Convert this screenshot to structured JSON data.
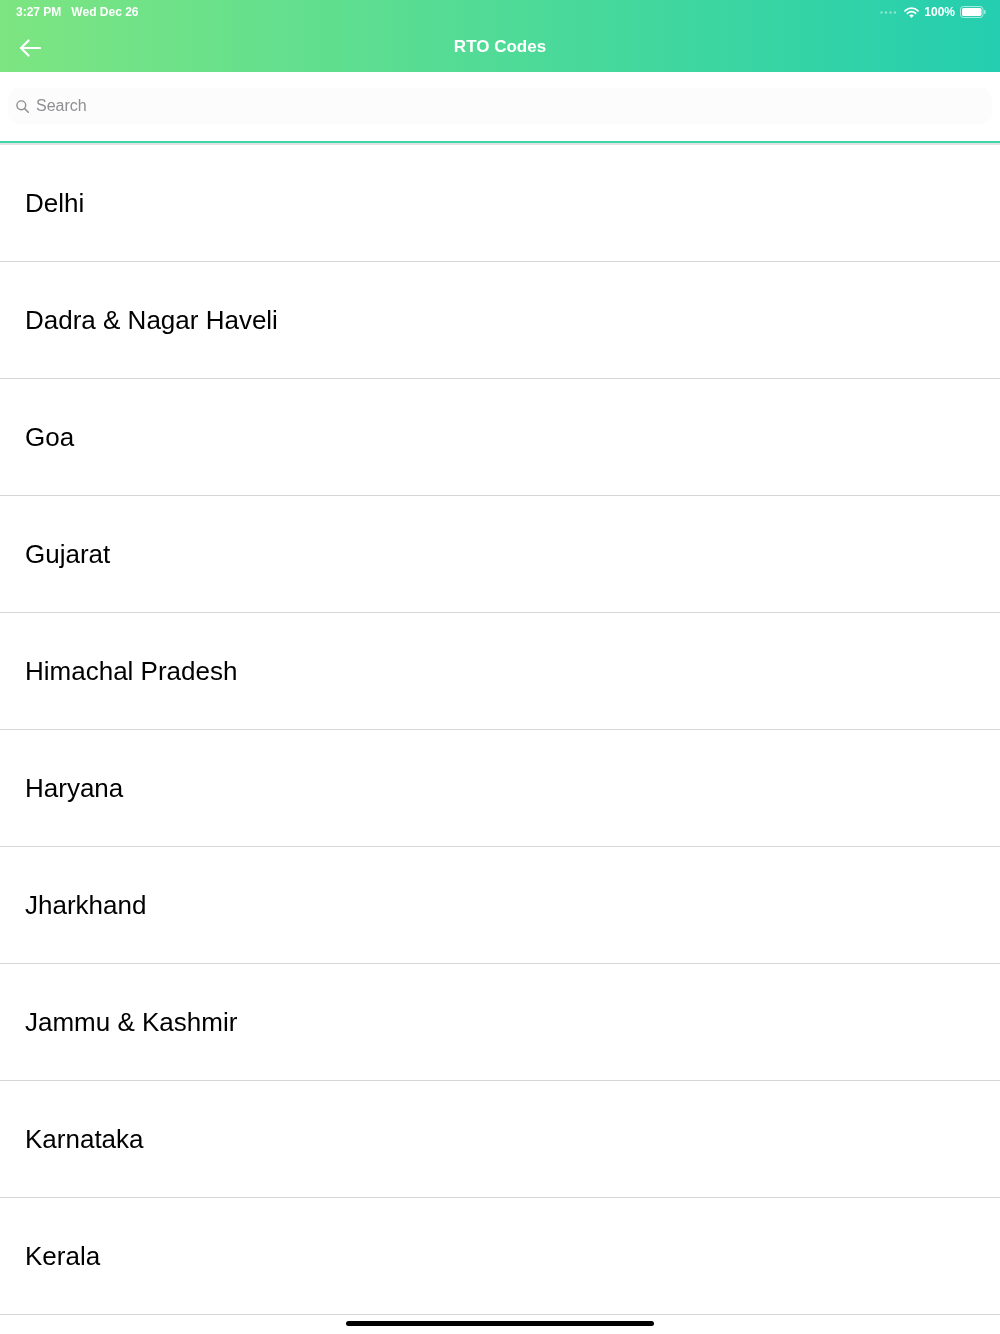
{
  "status_bar": {
    "time": "3:27 PM",
    "date": "Wed Dec 26",
    "battery": "100%"
  },
  "nav_bar": {
    "title": "RTO Codes"
  },
  "search": {
    "placeholder": "Search"
  },
  "states": [
    {
      "name": "Delhi"
    },
    {
      "name": "Dadra & Nagar Haveli"
    },
    {
      "name": "Goa"
    },
    {
      "name": "Gujarat"
    },
    {
      "name": "Himachal Pradesh"
    },
    {
      "name": "Haryana"
    },
    {
      "name": "Jharkhand"
    },
    {
      "name": "Jammu & Kashmir"
    },
    {
      "name": "Karnataka"
    },
    {
      "name": "Kerala"
    }
  ]
}
